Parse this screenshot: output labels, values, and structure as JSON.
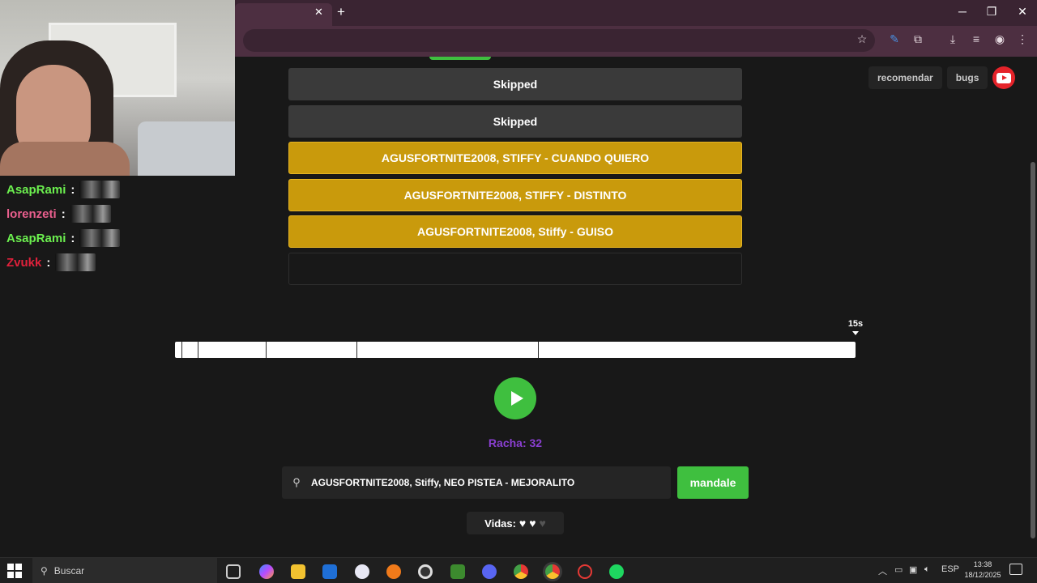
{
  "browser": {
    "tab_close": "✕",
    "new_tab": "+",
    "minimize": "─",
    "restore": "❐",
    "close": "✕"
  },
  "top_links": {
    "recommend_label": "recomendar",
    "bugs_label": "bugs"
  },
  "guesses": [
    {
      "text": "Skipped",
      "state": "skipped"
    },
    {
      "text": "Skipped",
      "state": "skipped"
    },
    {
      "text": "AGUSFORTNITE2008, STIFFY - CUANDO QUIERO",
      "state": "partial"
    },
    {
      "text": "AGUSFORTNITE2008, STIFFY - DISTINTO",
      "state": "partial"
    },
    {
      "text": "AGUSFORTNITE2008, Stiffy - GUISO",
      "state": "partial"
    },
    {
      "text": "",
      "state": "empty"
    }
  ],
  "timer": {
    "max_label": "15s"
  },
  "streak": "Racha: 32",
  "search": {
    "value": "AGUSFORTNITE2008, Stiffy, NEO PISTEA - MEJORALITO",
    "icon": "search-icon"
  },
  "submit_label": "mandale",
  "lives": {
    "label": "Vidas:",
    "total": 3,
    "remaining": 2,
    "heart_full": "♥",
    "heart_lost": "♥"
  },
  "chat": [
    {
      "user": "AsapRami",
      "color": "#6cf04f",
      "sep": ":"
    },
    {
      "user": "lorenzeti",
      "color": "#ea5f8e",
      "sep": ":"
    },
    {
      "user": "AsapRami",
      "color": "#6cf04f",
      "sep": ":"
    },
    {
      "user": "Zvukk",
      "color": "#e0213b",
      "sep": ":"
    }
  ],
  "taskbar": {
    "search_placeholder": "Buscar",
    "lang": "ESP",
    "time": "13:38",
    "date": "18/12/2025"
  }
}
